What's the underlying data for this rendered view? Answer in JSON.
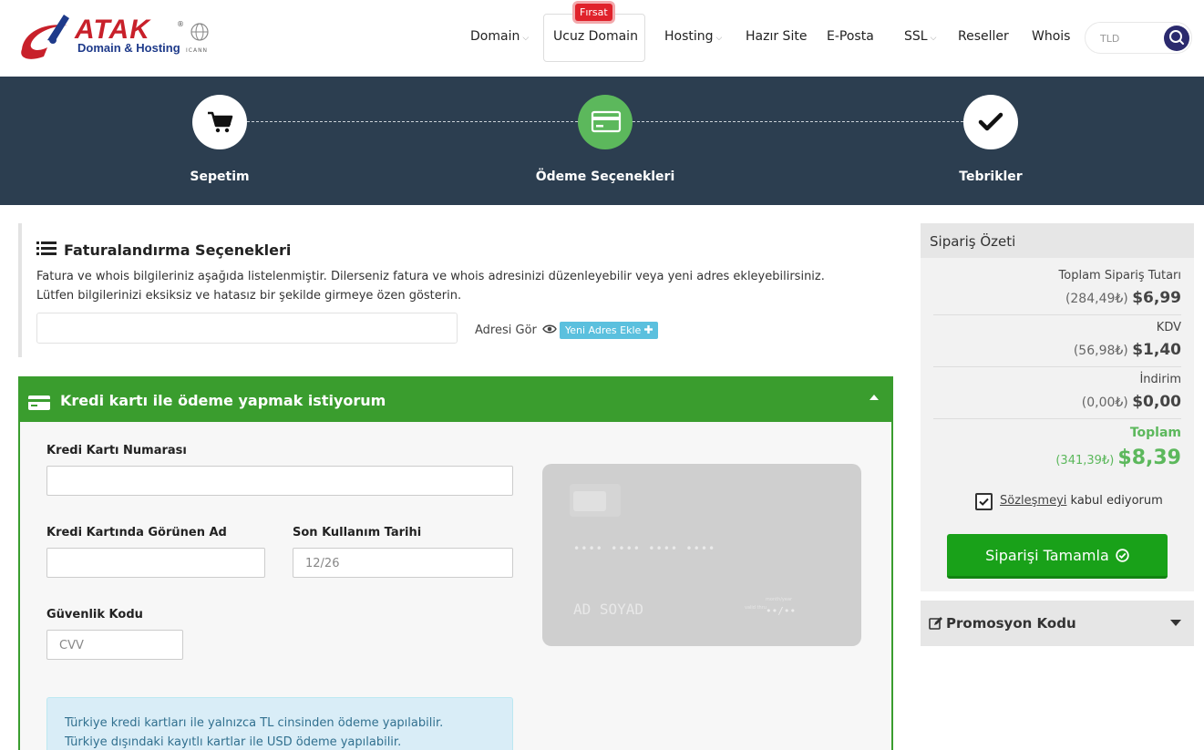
{
  "header": {
    "logo": {
      "brand": "ATAK",
      "tagline": "Domain & Hosting",
      "reg_mark": "®",
      "icann": "ICANN"
    },
    "nav": {
      "domain": "Domain",
      "ucuz_domain": "Ucuz Domain",
      "ucuz_badge": "Fırsat",
      "hosting": "Hosting",
      "hazir_site": "Hazır Site",
      "eposta": "E-Posta",
      "ssl": "SSL",
      "reseller": "Reseller",
      "whois": "Whois"
    },
    "search": {
      "placeholder": "TLD"
    }
  },
  "steps": {
    "cart": "Sepetim",
    "payment": "Ödeme Seçenekleri",
    "done": "Tebrikler"
  },
  "billing": {
    "title": "Faturalandırma Seçenekleri",
    "desc_1": "Fatura ve whois bilgileriniz aşağıda listelenmiştir. Dilerseniz fatura ve whois adresinizi düzenleyebilir veya yeni adres ekleyebilirsiniz.",
    "desc_2": "Lütfen bilgilerinizi eksiksiz ve hatasız bir şekilde girmeye özen gösterin.",
    "view_address": "Adresi Gör",
    "new_address": "Yeni Adres Ekle"
  },
  "credit_card": {
    "title": "Kredi kartı ile ödeme yapmak istiyorum",
    "number_label": "Kredi Kartı Numarası",
    "name_label": "Kredi Kartında Görünen Ad",
    "expiry_label": "Son Kullanım Tarihi",
    "expiry_placeholder": "12/26",
    "cvv_label": "Güvenlik Kodu",
    "cvv_placeholder": "CVV",
    "card_number_mask": "•••• •••• •••• ••••",
    "card_name_mask": "AD SOYAD",
    "card_expiry_mask": "••/••",
    "card_valid_thru": "valid thru",
    "card_month_year": "month/year",
    "info_1": "Türkiye kredi kartları ile yalnızca TL cinsinden ödeme yapılabilir.",
    "info_2": "Türkiye dışındaki kayıtlı kartlar ile USD ödeme yapılabilir."
  },
  "summary": {
    "title": "Sipariş Özeti",
    "rows": [
      {
        "label": "Toplam Sipariş Tutarı",
        "tl": "(284,49₺)",
        "usd": "$6,99"
      },
      {
        "label": "KDV",
        "tl": "(56,98₺)",
        "usd": "$1,40"
      },
      {
        "label": "İndirim",
        "tl": "(0,00₺)",
        "usd": "$0,00"
      }
    ],
    "total_label": "Toplam",
    "total_tl": "(341,39₺)",
    "total_usd": "$8,39",
    "agree_link": "Sözleşmeyi",
    "agree_rest": "kabul ediyorum",
    "complete": "Siparişi Tamamla"
  },
  "promo": {
    "title": "Promosyon Kodu"
  },
  "colors": {
    "brand_red": "#c8202a",
    "dark_bar": "#2c3e50",
    "green": "#3a9d2e",
    "button_green": "#19a119",
    "info_blue": "#31708f"
  }
}
